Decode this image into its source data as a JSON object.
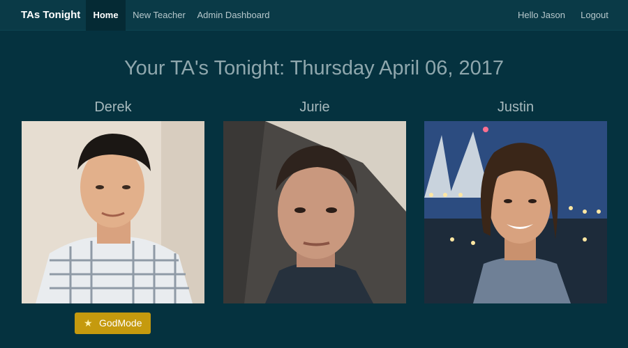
{
  "navbar": {
    "brand": "TAs Tonight",
    "items": [
      {
        "label": "Home",
        "active": true
      },
      {
        "label": "New Teacher",
        "active": false
      },
      {
        "label": "Admin Dashboard",
        "active": false
      }
    ],
    "greeting": "Hello Jason",
    "logout_label": "Logout"
  },
  "main": {
    "title": "Your TA's Tonight: Thursday April 06, 2017",
    "tas": [
      {
        "name": "Derek"
      },
      {
        "name": "Jurie"
      },
      {
        "name": "Justin"
      }
    ],
    "godmode_button": {
      "label": "GodMode",
      "icon": "star-icon"
    }
  },
  "colors": {
    "background": "#05323f",
    "navbar": "#0a3a47",
    "accent_button": "#c59a0e"
  }
}
